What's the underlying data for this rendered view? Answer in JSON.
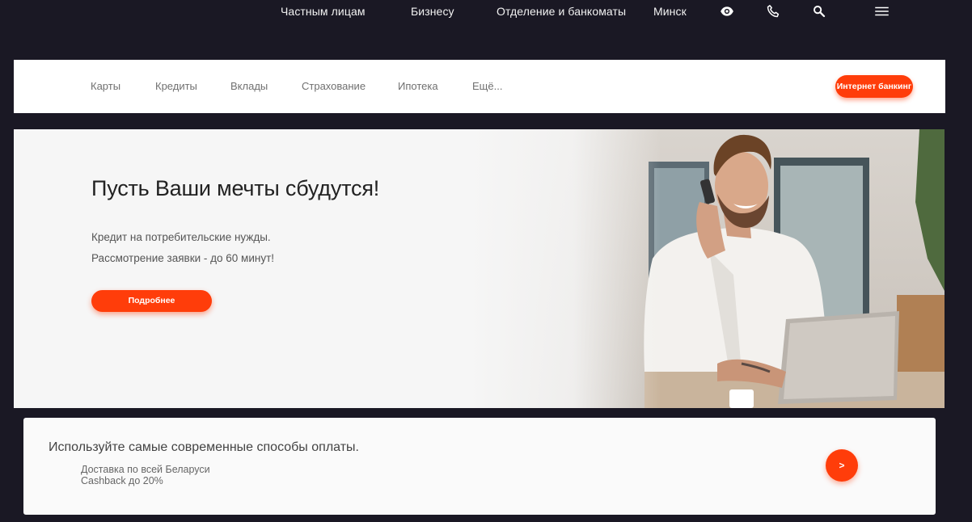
{
  "topnav": {
    "individuals": "Частным лицам",
    "business": "Бизнесу",
    "branches": "Отделение и банкоматы",
    "city": "Минск",
    "icons": [
      "eye-icon",
      "phone-icon",
      "search-icon",
      "menu-icon"
    ]
  },
  "menu": {
    "items": [
      "Карты",
      "Кредиты",
      "Вклады",
      "Страхование",
      "Ипотека",
      "Ещё..."
    ],
    "ib_button": "Интернет банкинг"
  },
  "hero": {
    "title": "Пусть Ваши мечты сбудутся!",
    "line1": "Кредит на потребительские нужды.",
    "line2": "Рассмотрение заявки - до 60 минут!",
    "button": "Подробнее"
  },
  "card": {
    "title": "Используйте самые современные способы оплаты.",
    "line1": "Доставка по всей Беларуси",
    "line2": "Cashback до 20%",
    "button": ">"
  },
  "colors": {
    "accent": "#ff3d0a",
    "page_bg": "#1a1824"
  }
}
